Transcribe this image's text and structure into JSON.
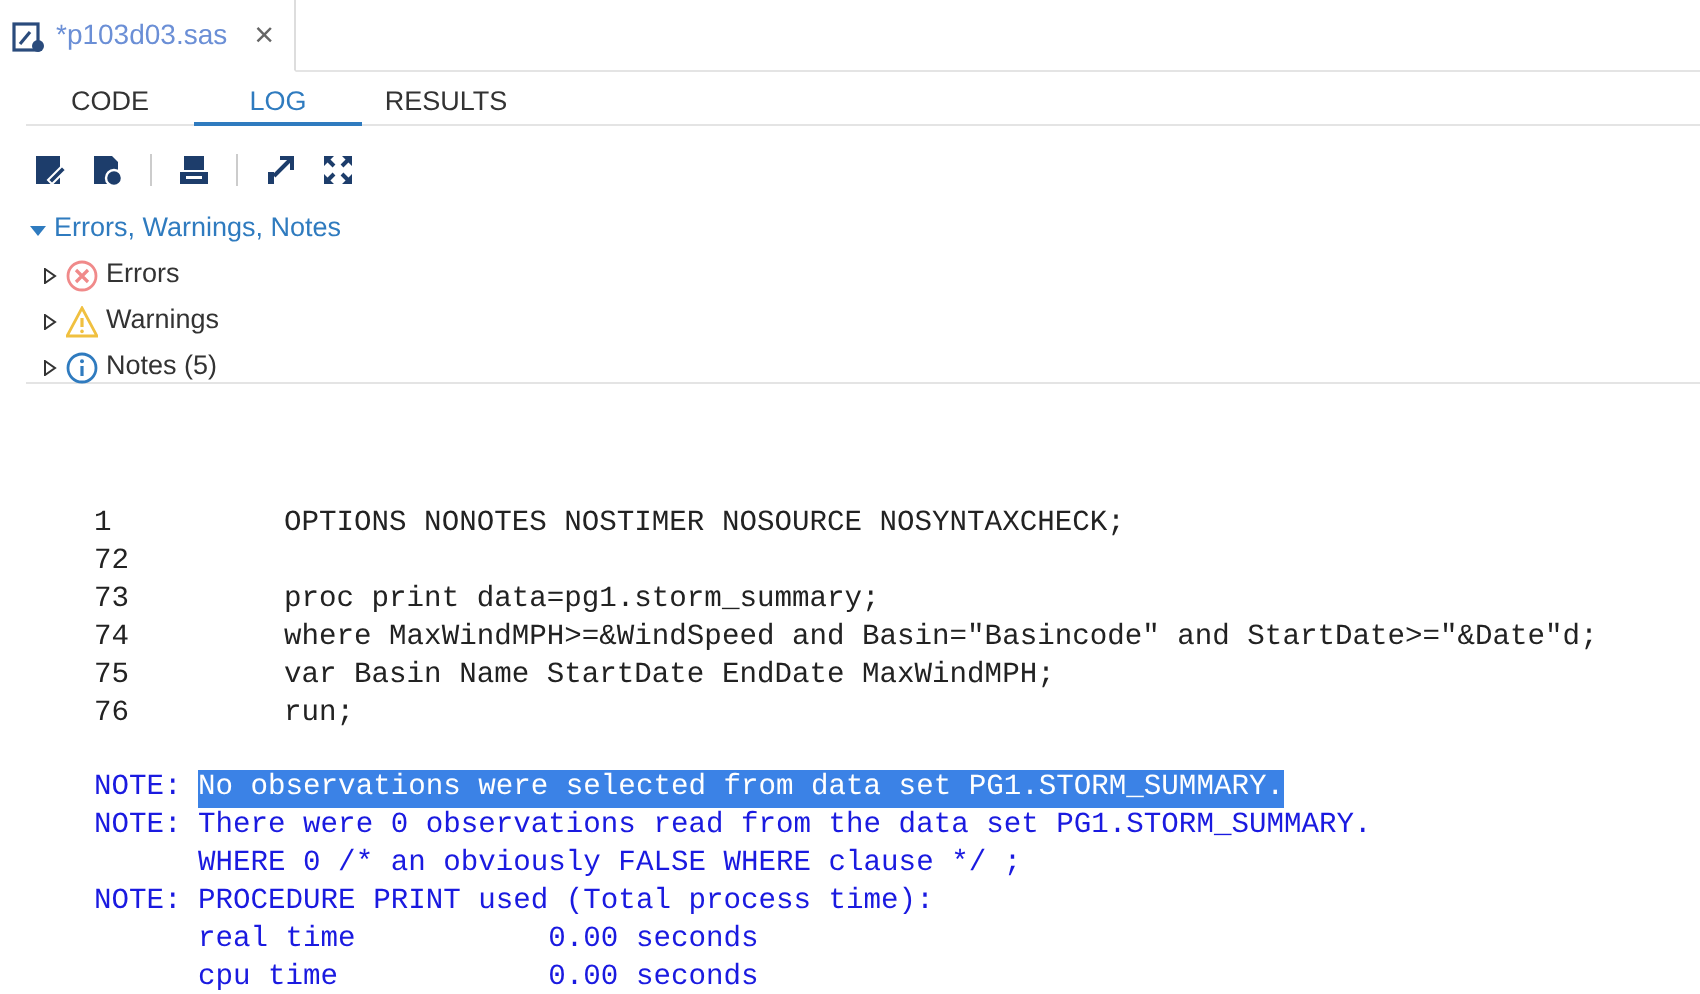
{
  "file_tab": {
    "title": "*p103d03.sas",
    "close": "×"
  },
  "tabs": [
    {
      "label": "CODE",
      "selected": false
    },
    {
      "label": "LOG",
      "selected": true
    },
    {
      "label": "RESULTS",
      "selected": false
    }
  ],
  "toolbar": [
    {
      "kind": "edit"
    },
    {
      "kind": "download"
    },
    {
      "kind": "print"
    },
    {
      "kind": "popout"
    },
    {
      "kind": "maximize"
    }
  ],
  "tree": {
    "label": "Errors, Warnings, Notes",
    "expanded": true,
    "children": [
      {
        "kind": "error",
        "label": "Errors",
        "expanded": false
      },
      {
        "kind": "warning",
        "label": "Warnings",
        "expanded": false
      },
      {
        "kind": "info",
        "label": "Notes (5)",
        "expanded": false
      }
    ]
  },
  "log": [
    {
      "kind": "source",
      "number": "1",
      "text": "OPTIONS NONOTES NOSTIMER NOSOURCE NOSYNTAXCHECK;"
    },
    {
      "kind": "source",
      "number": "72"
    },
    {
      "kind": "source",
      "number": "73",
      "text": "proc print data=pg1.storm_summary;"
    },
    {
      "kind": "source",
      "number": "74",
      "text": "where MaxWindMPH>=&WindSpeed and Basin=\"Basincode\" and StartDate>=\"&Date\"d;"
    },
    {
      "kind": "source",
      "number": "75",
      "text": "var Basin Name StartDate EndDate MaxWindMPH;"
    },
    {
      "kind": "source",
      "number": "76",
      "text": "run;"
    },
    {
      "kind": "gap"
    },
    {
      "kind": "note",
      "prefix": "NOTE:",
      "text": "No observations were selected from data set PG1.STORM_SUMMARY.",
      "highlighted": true
    },
    {
      "kind": "note",
      "prefix": "NOTE:",
      "text": "There were 0 observations read from the data set PG1.STORM_SUMMARY.",
      "highlighted": false
    },
    {
      "kind": "continuation",
      "text": "WHERE 0 /* an obviously FALSE WHERE clause */ ;"
    },
    {
      "kind": "note",
      "prefix": "NOTE:",
      "text": "PROCEDURE PRINT used (Total process time):",
      "highlighted": false
    },
    {
      "kind": "continuation",
      "text": "real time           0.00 seconds"
    },
    {
      "kind": "continuation",
      "text": "cpu time            0.00 seconds"
    }
  ]
}
